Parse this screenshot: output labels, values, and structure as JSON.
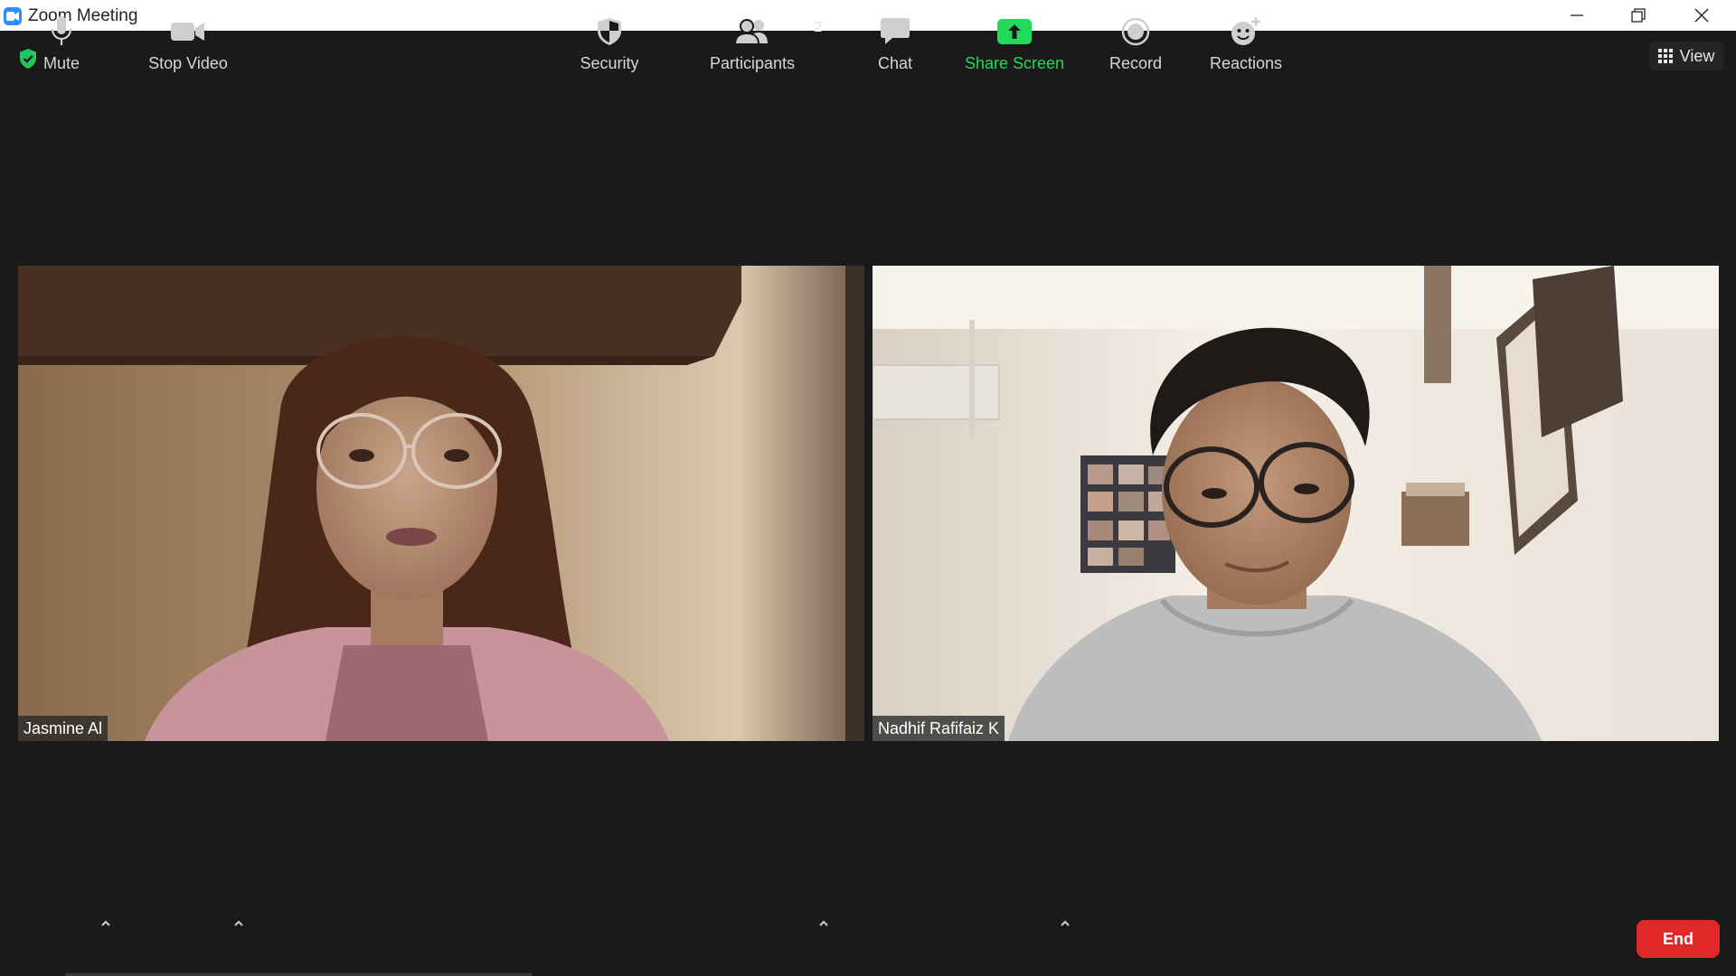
{
  "window": {
    "title": "Zoom Meeting"
  },
  "top": {
    "view_label": "View"
  },
  "participants": [
    {
      "name": "Jasmine Al"
    },
    {
      "name": "Nadhif Rafifaiz K"
    }
  ],
  "toolbar": {
    "mute": "Mute",
    "stop_video": "Stop Video",
    "security": "Security",
    "participants": "Participants",
    "participants_count": "2",
    "chat": "Chat",
    "share_screen": "Share Screen",
    "record": "Record",
    "reactions": "Reactions",
    "end": "End"
  },
  "colors": {
    "share_green": "#23d959",
    "end_red": "#e02828",
    "shield_green": "#22c55e",
    "zoom_blue": "#2d8cff"
  },
  "icons": [
    "shield-check-icon",
    "grid-icon",
    "microphone-icon",
    "video-camera-icon",
    "security-shield-icon",
    "participants-icon",
    "chat-icon",
    "share-screen-icon",
    "record-icon",
    "reactions-icon"
  ]
}
